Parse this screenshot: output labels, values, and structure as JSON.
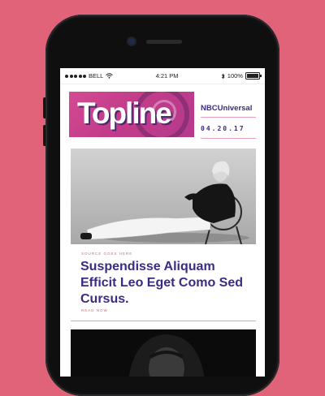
{
  "status_bar": {
    "carrier": "BELL",
    "time": "4:21 PM",
    "battery": "100%",
    "battery_level": 1.0
  },
  "header": {
    "logo": "Topline",
    "brand": "NBCUniversal",
    "date": "04.20.17"
  },
  "article": {
    "source": "SOURCE GOES HERE",
    "headline": "Suspendisse Aliquam Efficit Leo Eget Como Sed Cursus.",
    "read_more": "READ NOW"
  },
  "colors": {
    "background": "#e0637a",
    "accent_purple": "#3b2a86",
    "accent_pink": "#e0637a",
    "logo_bg": "#c23c8a"
  },
  "icons": [
    "signal-dots-icon",
    "wifi-icon",
    "bluetooth-icon",
    "battery-icon"
  ]
}
